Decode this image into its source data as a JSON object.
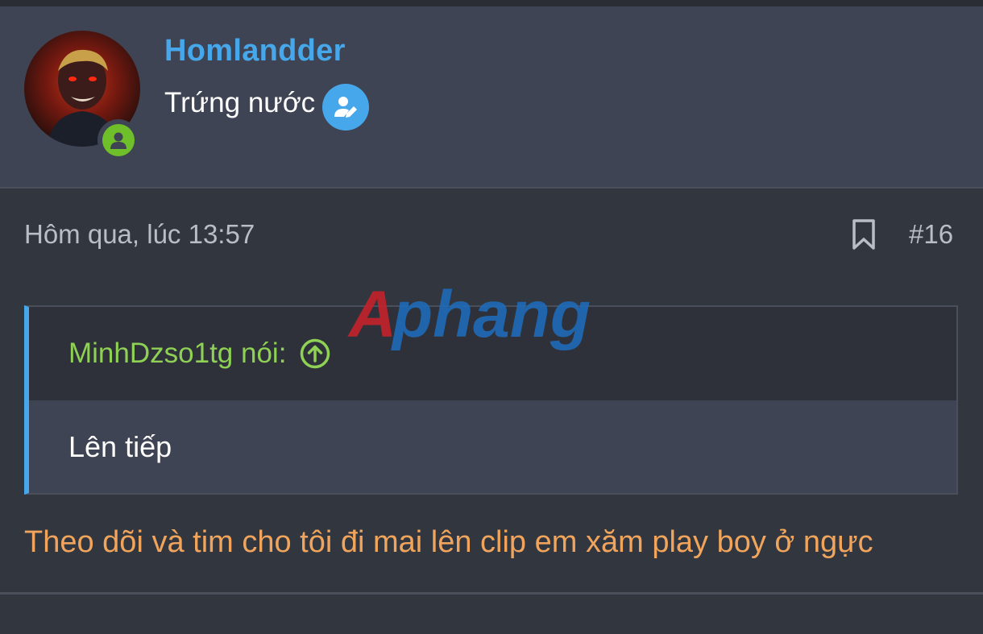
{
  "user": {
    "name": "Homlandder",
    "title": "Trứng nước"
  },
  "post": {
    "time": "Hôm qua, lúc 13:57",
    "number": "#16",
    "message": "Theo dõi và tim cho tôi đi mai lên clip em xăm play boy ở ngực"
  },
  "quote": {
    "author_line": "MinhDzso1tg nói:",
    "text": "Lên tiếp"
  },
  "watermark": {
    "text": "Aphang"
  },
  "icons": {
    "online": "user-online-icon",
    "edit": "user-edit-icon",
    "bookmark": "bookmark-icon",
    "quote_jump": "arrow-up-circle-icon"
  },
  "colors": {
    "username": "#47a7eb",
    "quote_author": "#8ed155",
    "message": "#f0a45c",
    "online": "#6fbf2a",
    "quote_border": "#47a7eb"
  }
}
